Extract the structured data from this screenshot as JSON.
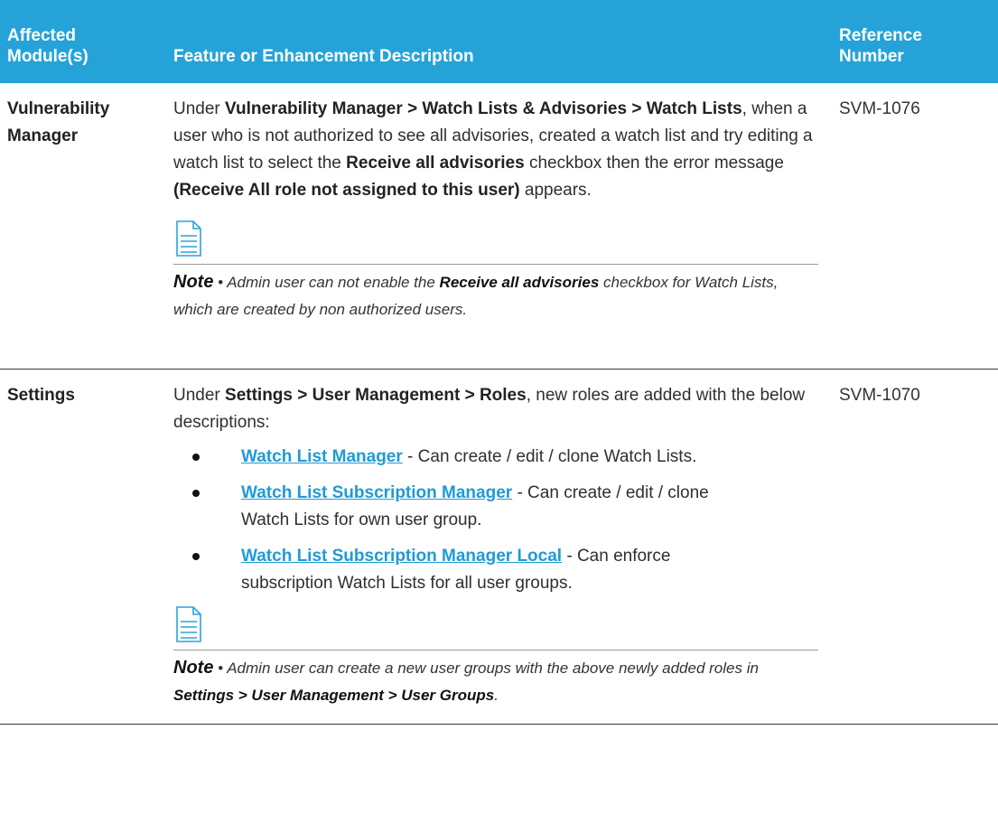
{
  "colors": {
    "header_bg": "#25a3d9",
    "link": "#1f9ad6",
    "rule": "#3a3a3a"
  },
  "header": {
    "module_line1": "Affected",
    "module_line2": "Module(s)",
    "description": "Feature or Enhancement Description",
    "reference_line1": "Reference",
    "reference_line2": "Number"
  },
  "rows": [
    {
      "module_line1": "Vulnerability",
      "module_line2": "Manager",
      "reference": "SVM-1076",
      "desc": {
        "t1": "Under ",
        "b1": "Vulnerability Manager > Watch Lists & Advisories > Watch Lists",
        "t2": ", when a user who is not authorized to see all advisories, created a watch list and try editing a watch list to select the ",
        "b2": "Receive all advisories",
        "t3": " checkbox then the error message ",
        "b3": "(Receive All role not assigned to this user)",
        "t4": " appears."
      },
      "note": {
        "icon": "note-document-icon",
        "label": "Note",
        "t1": " • Admin user can not enable the ",
        "b1": "Receive all advisories",
        "t2": " checkbox for Watch Lists, which are created by non authorized users."
      }
    },
    {
      "module": "Settings",
      "reference": "SVM-1070",
      "desc": {
        "t1": "Under ",
        "b1": "Settings > User Management > Roles",
        "t2": ", new roles are added with the below descriptions:"
      },
      "roles": [
        {
          "link": "Watch List Manager",
          "text": " - Can create / edit / clone Watch Lists."
        },
        {
          "link": "Watch List Subscription Manager",
          "text": " - Can create / edit / clone Watch Lists for own user group."
        },
        {
          "link": "Watch List Subscription Manager Local",
          "text": " - Can enforce subscription Watch Lists for all user groups."
        }
      ],
      "note": {
        "icon": "note-document-icon",
        "label": "Note",
        "t1": " • Admin user can create a new user groups with the above newly added roles in ",
        "b1": "Settings > User Management > User Groups",
        "t2": "."
      }
    }
  ]
}
